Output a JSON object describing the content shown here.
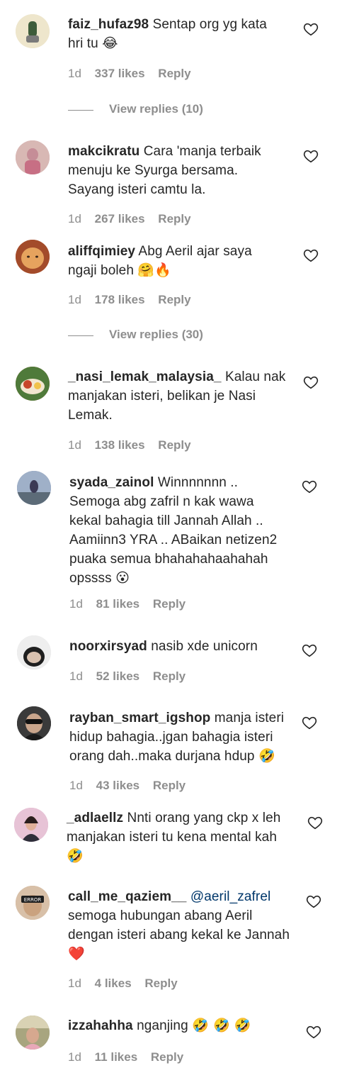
{
  "comments": [
    {
      "user": "faiz_hufaz98",
      "text": "Sentap org yg kata hri tu",
      "emoji": "😂",
      "time": "1d",
      "likes": "337 likes",
      "reply": "Reply",
      "avatar_color": "#e9dfc2"
    },
    {
      "user": "makcikratu",
      "text": "Cara 'manja terbaik menuju ke Syurga bersama. Sayang isteri camtu la.",
      "emoji": "",
      "time": "1d",
      "likes": "267 likes",
      "reply": "Reply",
      "avatar_color": "#cf9ca6"
    },
    {
      "user": "aliffqimiey",
      "text": "Abg Aeril ajar saya ngaji boleh",
      "emoji": "🤗🔥",
      "time": "1d",
      "likes": "178 likes",
      "reply": "Reply",
      "avatar_color": "#c9653a"
    },
    {
      "user": "_nasi_lemak_malaysia_",
      "text": "Kalau nak manjakan isteri, belikan je Nasi Lemak.",
      "emoji": "",
      "time": "1d",
      "likes": "138 likes",
      "reply": "Reply",
      "avatar_color": "#b8582a"
    },
    {
      "user": "syada_zainol",
      "text": "Winnnnnnn .. Semoga abg zafril n kak wawa kekal bahagia till Jannah Allah .. Aamiinn3 YRA .. ABaikan netizen2 puaka semua bhahahahaahahah opssss",
      "emoji": "😮",
      "time": "1d",
      "likes": "81 likes",
      "reply": "Reply",
      "avatar_color": "#6f7fa0"
    },
    {
      "user": "noorxirsyad",
      "text": "nasib xde unicorn",
      "emoji": "",
      "time": "1d",
      "likes": "52 likes",
      "reply": "Reply",
      "avatar_color": "#d9d9d9"
    },
    {
      "user": "rayban_smart_igshop",
      "text": "manja isteri hidup bahagia..jgan bahagia isteri orang dah..maka durjana hdup",
      "emoji": "🤣",
      "time": "1d",
      "likes": "43 likes",
      "reply": "Reply",
      "avatar_color": "#2a2a2a"
    },
    {
      "user": "_adlaellz",
      "text": "Nnti orang yang ckp x leh manjakan isteri tu kena mental kah",
      "emoji": "🤣",
      "time": "",
      "likes": "",
      "reply": "",
      "avatar_color": "#d7a9c6"
    },
    {
      "user": "call_me_qaziem__",
      "mention": "@aeril_zafrel",
      "text": "semoga hubungan abang Aeril dengan isteri abang kekal ke Jannah",
      "emoji": "❤️",
      "time": "1d",
      "likes": "4 likes",
      "reply": "Reply",
      "avatar_color": "#c9a98a"
    },
    {
      "user": "izzahahha",
      "text": "nganjing",
      "emoji": "🤣 🤣 🤣",
      "time": "1d",
      "likes": "11 likes",
      "reply": "Reply",
      "avatar_color": "#b7b08e"
    }
  ],
  "view_replies": [
    {
      "label": "View replies (10)"
    },
    {
      "label": "View replies (30)"
    }
  ],
  "icons": {
    "like": "heart-outline-icon"
  }
}
